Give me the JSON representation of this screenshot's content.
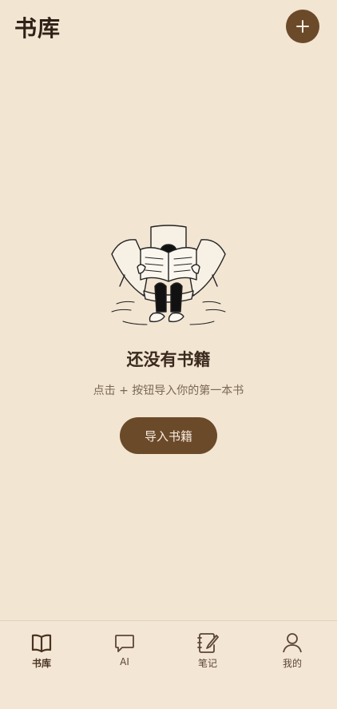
{
  "header": {
    "title": "书库",
    "add_label": "+"
  },
  "empty_state": {
    "title": "还没有书籍",
    "subtitle": "点击 + 按钮导入你的第一本书",
    "button": "导入书籍"
  },
  "tabbar": {
    "items": [
      {
        "label": "书库",
        "icon": "book-icon",
        "active": true
      },
      {
        "label": "AI",
        "icon": "chat-bubble-icon",
        "active": false
      },
      {
        "label": "笔记",
        "icon": "notebook-icon",
        "active": false
      },
      {
        "label": "我的",
        "icon": "user-icon",
        "active": false
      }
    ]
  },
  "colors": {
    "background": "#f2e5d2",
    "accent": "#6b4a2a",
    "text": "#3b2a1d"
  }
}
